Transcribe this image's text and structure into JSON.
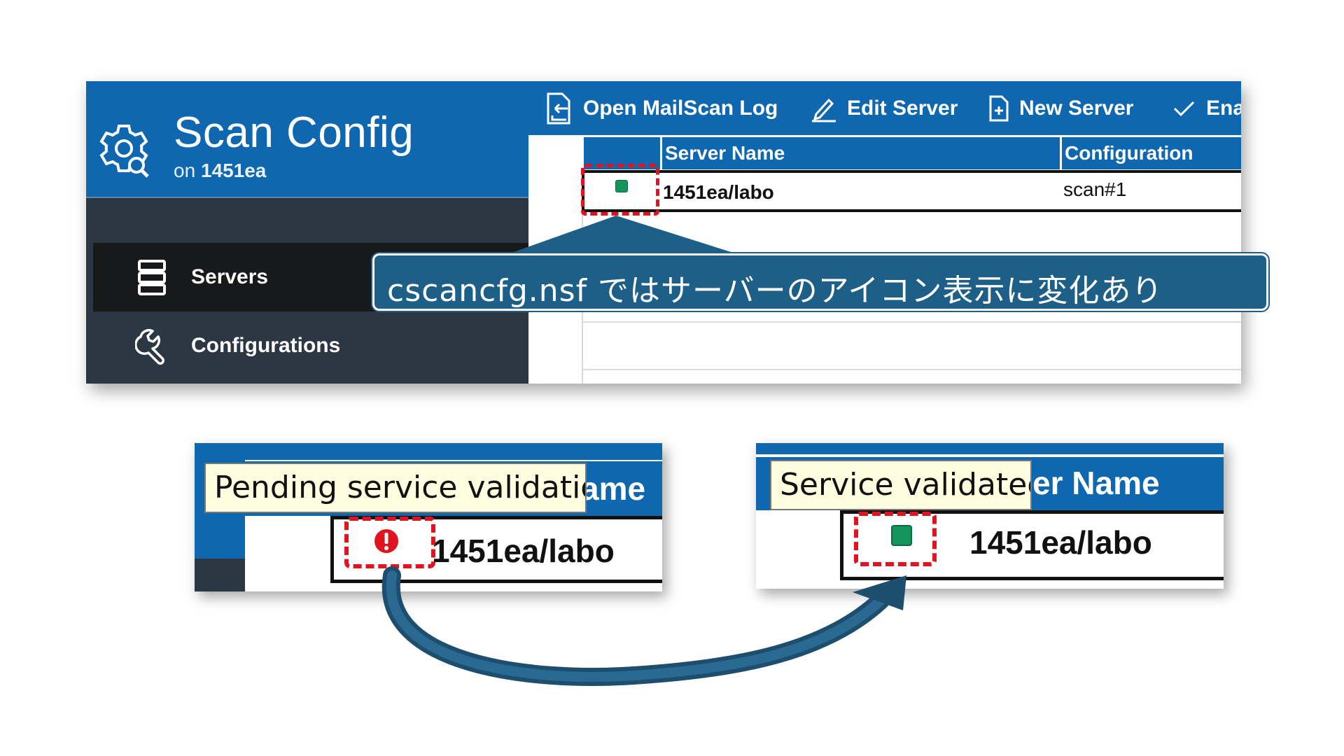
{
  "app": {
    "title": "Scan Config",
    "subtitle_prefix": "on",
    "subtitle_server": "1451ea"
  },
  "sidebar": {
    "items": [
      {
        "label": "Servers",
        "icon": "server-stack-icon",
        "selected": true
      },
      {
        "label": "Configurations",
        "icon": "wrench-icon",
        "selected": false
      }
    ]
  },
  "toolbar": {
    "open_log": "Open MailScan Log",
    "edit_server": "Edit Server",
    "new_server": "New Server",
    "enable": "Ena"
  },
  "grid": {
    "columns": [
      "",
      "Server Name",
      "Configuration"
    ],
    "rows": [
      {
        "status": "validated",
        "status_color": "#14955c",
        "server_name": "1451ea/labo",
        "configuration": "scan#1"
      }
    ]
  },
  "callout": {
    "text": "cscancfg.nsf ではサーバーのアイコン表示に変化あり",
    "color": "#1d5f86"
  },
  "before": {
    "tooltip": "Pending service validatio",
    "header_fragment": "ame",
    "server_name": "1451ea/labo",
    "status_icon": "exclamation-circle-icon",
    "status_color": "#e1131f"
  },
  "after": {
    "tooltip": "Service validatec",
    "header_fragment": "er Name",
    "server_name": "1451ea/labo",
    "status_icon": "green-square-icon",
    "status_color": "#14955c"
  },
  "colors": {
    "brand_blue": "#0f67b0",
    "sidebar_dark": "#2b3843",
    "highlight_red": "#e1131f",
    "arrow_navy": "#1d4e6e"
  }
}
